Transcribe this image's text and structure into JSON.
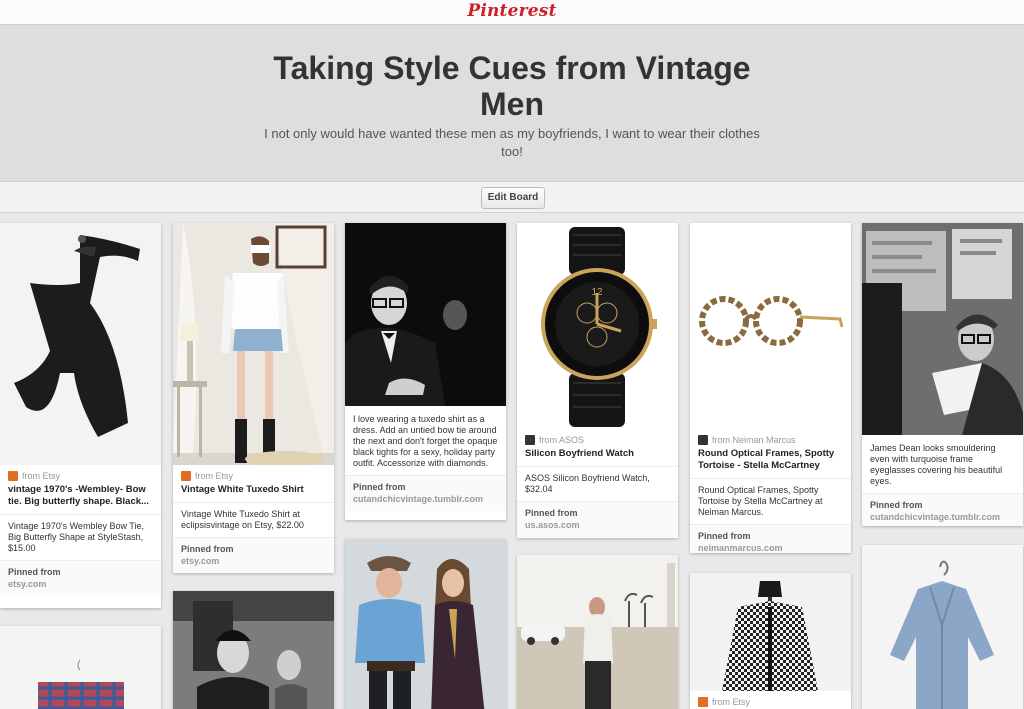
{
  "header": {
    "logo": "Pinterest"
  },
  "board": {
    "title": "Taking Style Cues from Vintage Men",
    "description": "I not only would have wanted these men as my boyfriends, I want to wear their clothes too!",
    "edit_label": "Edit Board"
  },
  "pins": [
    {
      "source": "from Etsy",
      "title": "vintage 1970's -Wembley- Bow tie. Big butterfly shape. Black...",
      "description": "Vintage 1970's Wembley Bow Tie, Big Butterfly Shape at StyleStash, $15.00",
      "pinned_label": "Pinned from",
      "pinned_site": "etsy.com"
    },
    {
      "source": "from Etsy",
      "title": "Vintage White Tuxedo Shirt",
      "description": "Vintage White Tuxedo Shirt at eclipsisvintage on Etsy, $22.00",
      "pinned_label": "Pinned from",
      "pinned_site": "etsy.com"
    },
    {
      "description": "I love wearing a tuxedo shirt as a dress. Add an untied bow tie around the next and don't forget the opaque black tights for a sexy, holiday party outfit. Accessorize with diamonds.",
      "pinned_label": "Pinned from",
      "pinned_site": "cutandchicvintage.tumblr.com"
    },
    {
      "source": "from ASOS",
      "title": "Silicon Boyfriend Watch",
      "description": "ASOS Silicon Boyfriend Watch, $32.04",
      "pinned_label": "Pinned from",
      "pinned_site": "us.asos.com"
    },
    {
      "source": "from Neiman Marcus",
      "title": "Round Optical Frames, Spotty Tortoise - Stella McCartney",
      "description": "Round Optical Frames, Spotty Tortoise by Stella McCartney at Neiman Marcus.",
      "pinned_label": "Pinned from",
      "pinned_site": "neimanmarcus.com"
    },
    {
      "description": "James Dean looks smouldering even with turquoise frame eyeglasses covering his beautiful eyes.",
      "pinned_label": "Pinned from",
      "pinned_site": "cutandchicvintage.tumblr.com"
    },
    {
      "source": "from Etsy"
    }
  ]
}
